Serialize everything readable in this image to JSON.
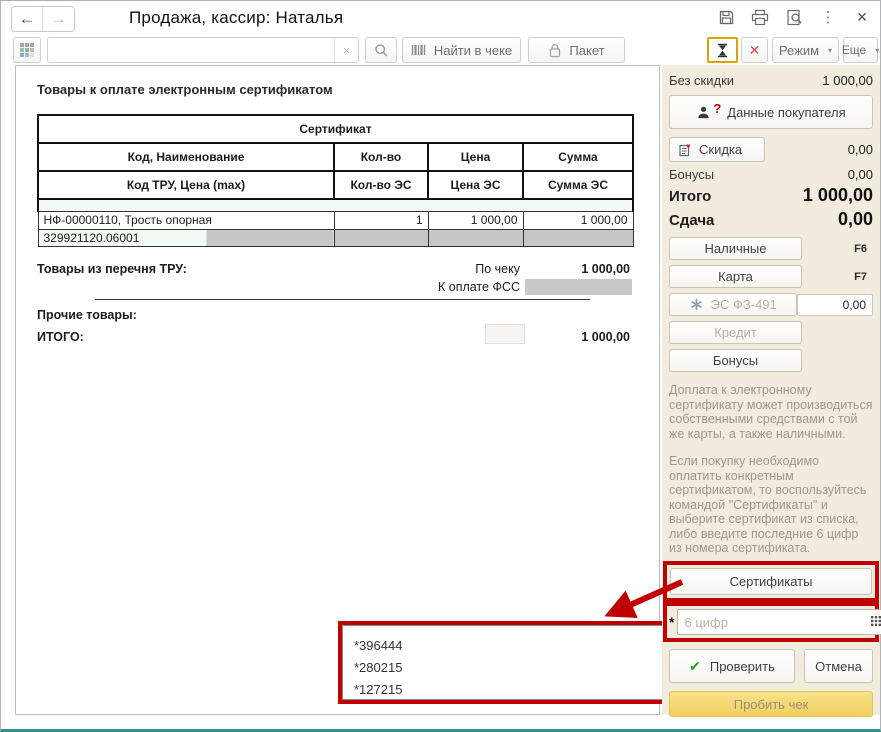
{
  "window": {
    "title": "Продажа, кассир: Наталья"
  },
  "icons": {
    "back": "←",
    "forward": "→",
    "close": "×",
    "menu_dots": "⋮",
    "clear": "×",
    "red_close": "✕",
    "check": "✔",
    "dropdown": "▾",
    "required": "*",
    "question": "?"
  },
  "toolbar": {
    "search_value": "",
    "find_in_receipt": "Найти в чеке",
    "packet": "Пакет",
    "mode": "Режим",
    "more": "Еще"
  },
  "document": {
    "heading": "Товары к оплате электронным сертификатом",
    "table": {
      "group_header": "Сертификат",
      "col1a": "Код, Наименование",
      "col2a": "Кол-во",
      "col3a": "Цена",
      "col4a": "Сумма",
      "col1b": "Код ТРУ, Цена (max)",
      "col2b": "Кол-во ЭС",
      "col3b": "Цена ЭС",
      "col4b": "Сумма ЭС",
      "row1": {
        "name": "НФ-00000110, Трость опорная",
        "qty": "1",
        "price": "1 000,00",
        "sum": "1 000,00"
      },
      "row2": {
        "code": "329921120.06001"
      }
    },
    "tru_label": "Товары из перечня ТРУ:",
    "by_receipt_label": "По чеку",
    "by_receipt_value": "1 000,00",
    "fss_label": "К оплате ФСС",
    "other_goods_label": "Прочие товары:",
    "total_label": "ИТОГО:",
    "total_value": "1 000,00"
  },
  "annotations": {
    "certificates_list": [
      "*396444",
      "*280215",
      "*127215"
    ]
  },
  "panel": {
    "no_discount_label": "Без скидки",
    "no_discount_value": "1 000,00",
    "customer_button": "Данные покупателя",
    "discount_button": "Скидка",
    "discount_value": "0,00",
    "bonuses_label": "Бонусы",
    "bonuses_value": "0,00",
    "total_label": "Итого",
    "total_value": "1 000,00",
    "change_label": "Сдача",
    "change_value": "0,00",
    "cash_button": "Наличные",
    "cash_key": "F6",
    "card_button": "Карта",
    "card_key": "F7",
    "es_button": "ЭС ФЗ-491",
    "es_value": "0,00",
    "credit_button": "Кредит",
    "bonuses_button": "Бонусы",
    "hint1": "Доплата к электронному сертификату может производиться собственными средствами с той же карты, а также наличными.",
    "hint2": "Если покупку необходимо оплатить конкретным сертификатом, то воспользуйтесь командой \"Сертификаты\" и выберите сертификат из списка, либо введите последние 6 цифр из номера сертификата.",
    "certificates_button": "Сертификаты",
    "required_mark": "*",
    "digits_placeholder": "6 цифр",
    "check_button": "Проверить",
    "cancel_button": "Отмена",
    "commit_button": "Пробить чек"
  },
  "colors": {
    "annotation_red": "#c00000",
    "panel_bg": "#f1ecdd",
    "highlight_gold": "#dfa300",
    "window_teal": "#37918e",
    "commit_yellow": "#f1cf5d"
  }
}
